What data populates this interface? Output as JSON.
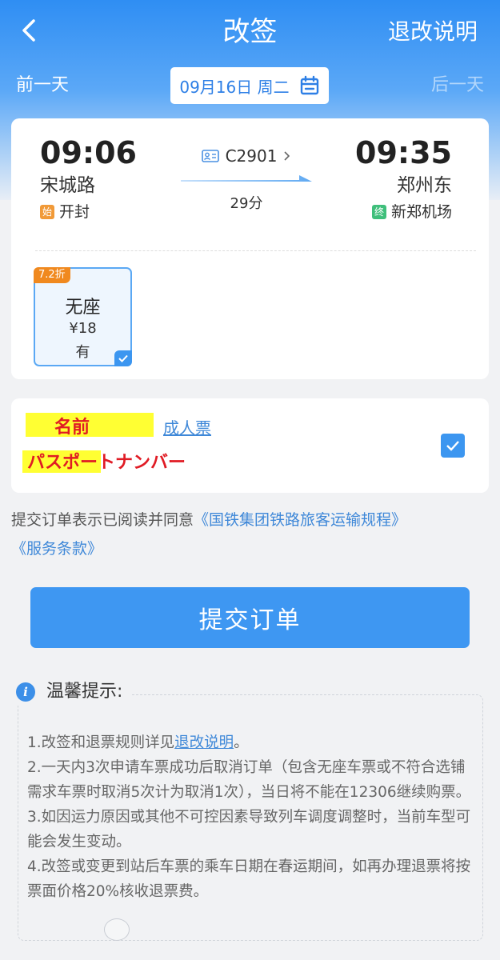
{
  "header": {
    "title": "改签",
    "refund_link": "退改说明"
  },
  "date_bar": {
    "prev": "前一天",
    "date": "09月16日 周二",
    "next": "后一天"
  },
  "train": {
    "departure_time": "09:06",
    "departure_station": "宋城路",
    "departure_badge": "始",
    "departure_city": "开封",
    "train_number": "C2901",
    "duration": "29分",
    "arrival_time": "09:35",
    "arrival_station": "郑州东",
    "arrival_badge": "终",
    "arrival_city": "新郑机场"
  },
  "seat": {
    "discount": "7.2折",
    "name": "无座",
    "price": "¥18",
    "availability": "有"
  },
  "passenger": {
    "name": "名前",
    "ticket_type": "成人票",
    "passport": "パスポートナンバー"
  },
  "agreement": {
    "prefix": "提交订单表示已阅读并同意",
    "link1": "《国铁集团铁路旅客运输规程》",
    "link2": "《服务条款》"
  },
  "submit_label": "提交订单",
  "tips": {
    "title": "温馨提示:",
    "item1_prefix": "1.改签和退票规则详见",
    "item1_link": "退改说明",
    "item1_suffix": "。",
    "item2": "2.一天内3次申请车票成功后取消订单（包含无座车票或不符合选铺需求车票时取消5次计为取消1次），当日将不能在12306继续购票。",
    "item3": "3.如因运力原因或其他不可控因素导致列车调度调整时，当前车型可能会发生变动。",
    "item4": "4.改签或变更到站后车票的乘车日期在春运期间，如再办理退票将按票面价格20%核收退票费。"
  },
  "colors": {
    "primary": "#3e97f2",
    "link": "#3f88d8",
    "discount": "#f0891f",
    "start_badge": "#f19a38",
    "end_badge": "#3fbf7b",
    "highlight": "#ffff33",
    "redacted_text": "#e01b24"
  },
  "icons": [
    "back-chevron",
    "calendar",
    "id-card",
    "chevron-right",
    "check",
    "info"
  ]
}
